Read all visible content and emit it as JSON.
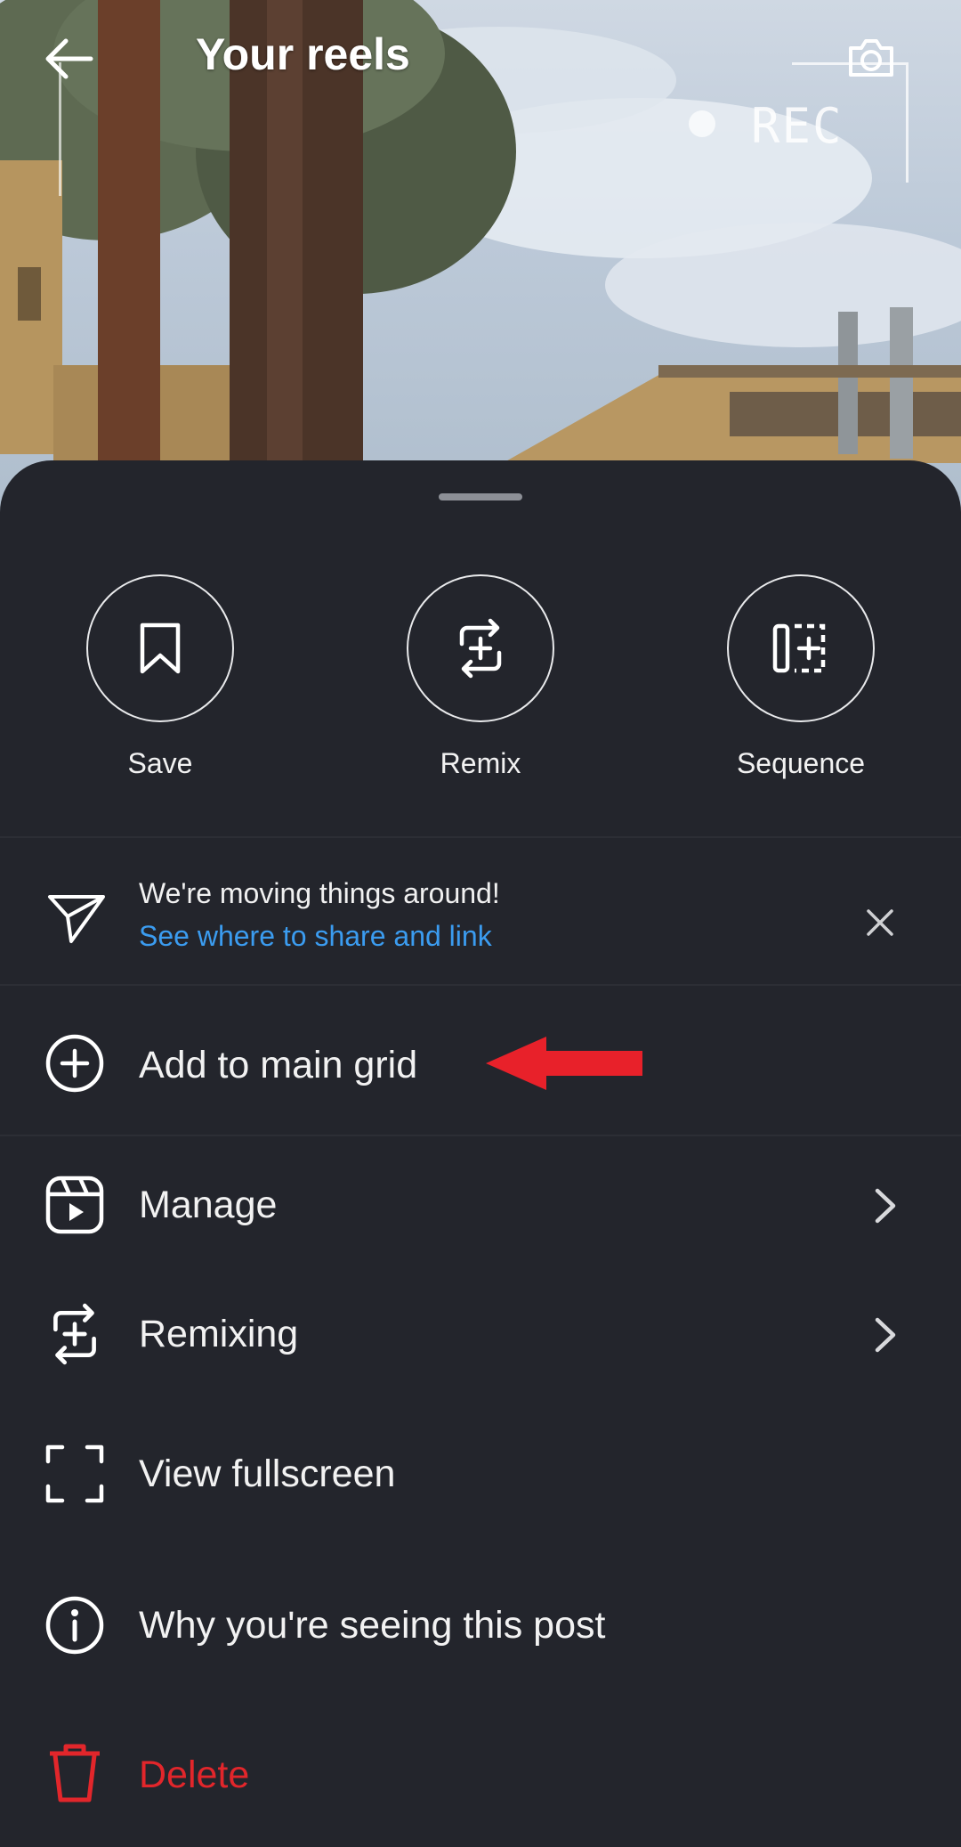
{
  "header": {
    "title": "Your reels",
    "rec_label": "REC"
  },
  "icons": {
    "back": "arrow-left-icon",
    "camera": "camera-icon",
    "save": "bookmark-icon",
    "remix": "remix-icon",
    "sequence": "sequence-icon",
    "share": "paper-plane-icon",
    "close": "close-icon",
    "add": "plus-circle-icon",
    "manage": "reels-clapper-icon",
    "remixing": "remix-icon",
    "fullscreen": "fullscreen-icon",
    "info": "info-icon",
    "delete": "trash-icon",
    "chevron": "chevron-right-icon"
  },
  "quick_actions": [
    {
      "label": "Save"
    },
    {
      "label": "Remix"
    },
    {
      "label": "Sequence"
    }
  ],
  "notice": {
    "title": "We're moving things around!",
    "link": "See where to share and link"
  },
  "menu": {
    "add_to_grid": "Add to main grid",
    "manage": "Manage",
    "remixing": "Remixing",
    "view_fullscreen": "View fullscreen",
    "why_seeing": "Why you're seeing this post",
    "delete": "Delete"
  },
  "colors": {
    "sheet_background": "#23252c",
    "link_blue": "#3b9cf0",
    "delete_red": "#e2262b",
    "annotation_arrow_red": "#e8212a"
  }
}
